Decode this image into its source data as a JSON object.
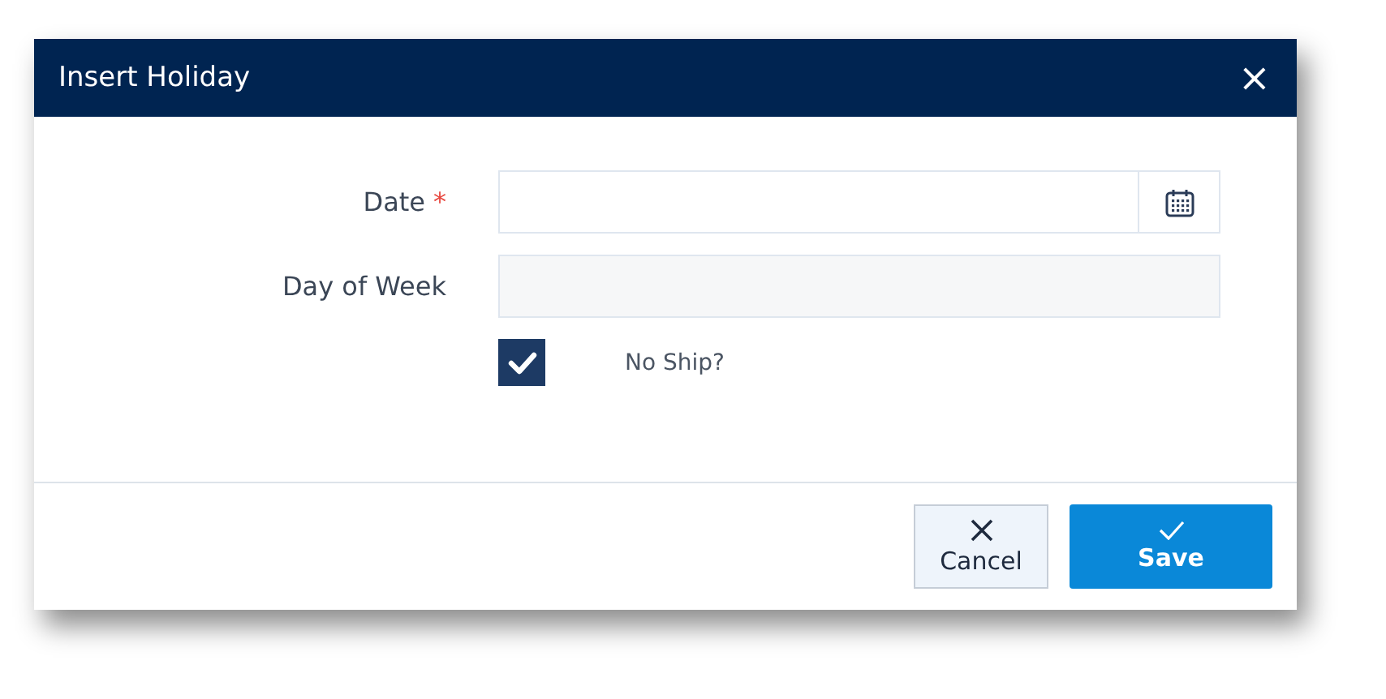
{
  "window": {
    "title": "Insert Holiday",
    "close": "×"
  },
  "fields": [
    {
      "label": "Date",
      "required_mark": "*",
      "kind": "date"
    },
    {
      "label": "Day of Week",
      "kind": "readonly"
    }
  ],
  "no_ship": {
    "label": "No Ship?",
    "checked": true
  },
  "buttons": [
    {
      "label": "Cancel",
      "kind": "cancel"
    },
    {
      "label": "Save",
      "kind": "save"
    }
  ]
}
